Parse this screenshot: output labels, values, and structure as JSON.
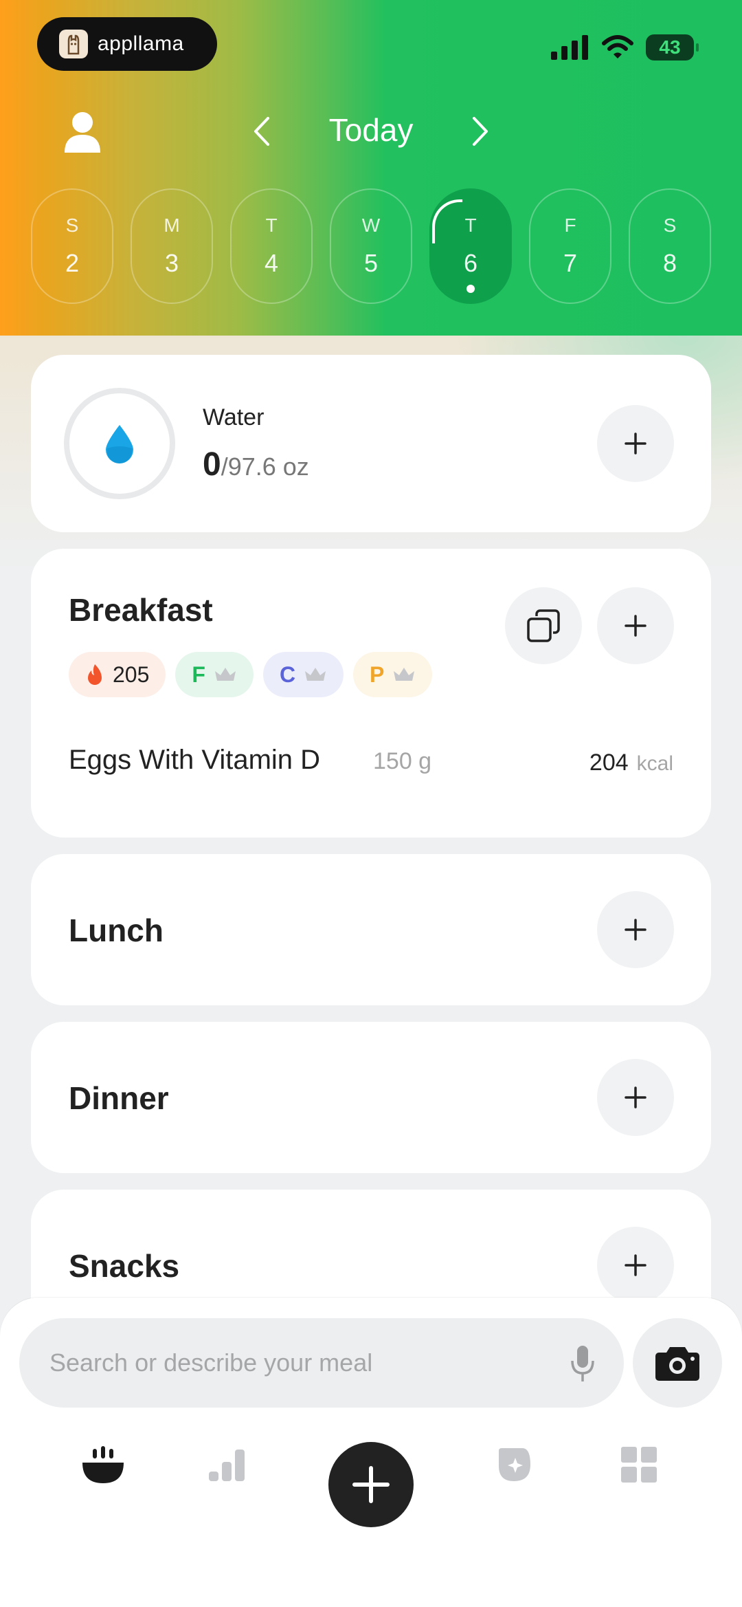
{
  "status": {
    "brand": "appllama",
    "battery": "43"
  },
  "nav": {
    "title": "Today"
  },
  "week": [
    {
      "letter": "S",
      "num": "2"
    },
    {
      "letter": "M",
      "num": "3"
    },
    {
      "letter": "T",
      "num": "4"
    },
    {
      "letter": "W",
      "num": "5"
    },
    {
      "letter": "T",
      "num": "6",
      "active": true
    },
    {
      "letter": "F",
      "num": "7"
    },
    {
      "letter": "S",
      "num": "8"
    }
  ],
  "water": {
    "label": "Water",
    "current": "0",
    "goal": "/97.6 oz"
  },
  "breakfast": {
    "title": "Breakfast",
    "calories": "205",
    "fat": "F",
    "carbs": "C",
    "protein": "P",
    "items": [
      {
        "name": "Eggs With Vitamin D",
        "qty": "150 g",
        "kcal": "204",
        "unit": "kcal"
      }
    ]
  },
  "lunch": {
    "title": "Lunch"
  },
  "dinner": {
    "title": "Dinner"
  },
  "snacks": {
    "title": "Snacks"
  },
  "search": {
    "placeholder": "Search or describe your meal"
  },
  "colors": {
    "accent": "#1dbf5f",
    "orange": "#ff9f1c",
    "fat": "#1cb85a",
    "carbs": "#5b63d9",
    "protein": "#f0a52a",
    "water": "#1aa6e6"
  }
}
